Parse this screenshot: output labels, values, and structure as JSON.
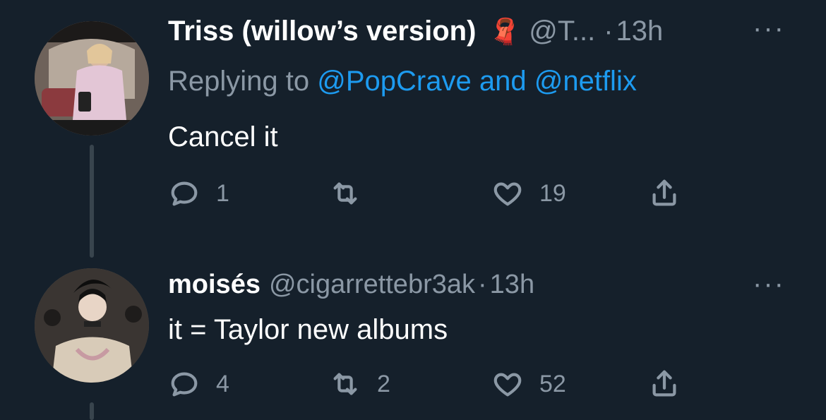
{
  "tweets": [
    {
      "display_name": "Triss (willow’s version)",
      "emoji": "🧣",
      "handle": "@T...",
      "dot": "·",
      "time": "13h",
      "more": "···",
      "replying_prefix": "Replying to",
      "replying_mention_1": "@PopCrave",
      "replying_and": "and",
      "replying_mention_2": "@netflix",
      "text": "Cancel it",
      "reply_count": "1",
      "retweet_count": "",
      "like_count": "19"
    },
    {
      "display_name": "moisés",
      "handle": "@cigarrettebr3ak",
      "dot": "·",
      "time": "13h",
      "more": "···",
      "text": "it = Taylor new albums",
      "reply_count": "4",
      "retweet_count": "2",
      "like_count": "52"
    }
  ],
  "colors": {
    "background": "#15202b",
    "text": "#ffffff",
    "muted": "#8b98a5",
    "link": "#1d9bf0",
    "thread": "#38444d"
  },
  "icons": [
    "reply-icon",
    "retweet-icon",
    "like-icon",
    "share-icon",
    "scarf-icon",
    "more-icon"
  ]
}
